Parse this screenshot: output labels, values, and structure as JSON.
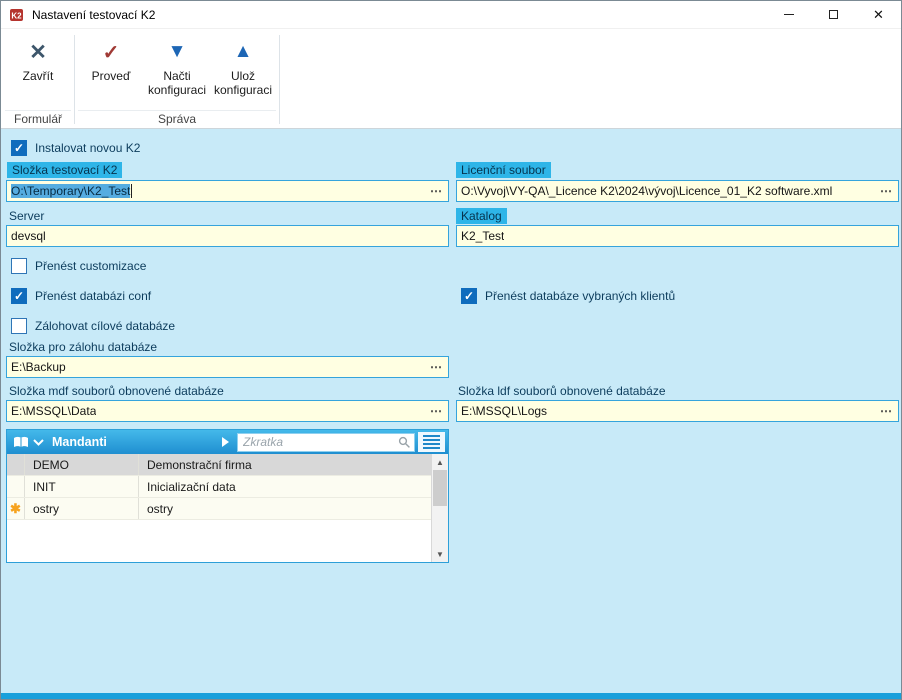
{
  "window": {
    "title": "Nastavení testovací K2"
  },
  "ribbon": {
    "groups": [
      "Formulář",
      "Správa"
    ],
    "buttons": [
      {
        "label": "Zavřít",
        "icon": "close-x-icon"
      },
      {
        "label": "Proveď",
        "icon": "execute-check-icon"
      },
      {
        "label": "Načti konfiguraci",
        "icon": "arrow-down-icon"
      },
      {
        "label": "Ulož konfiguraci",
        "icon": "arrow-up-icon"
      }
    ]
  },
  "form": {
    "install_checkbox": {
      "label": "Instalovat novou K2",
      "checked": true
    },
    "fields": {
      "test_folder": {
        "label": "Složka testovací K2",
        "value": "O:\\Temporary\\K2_Test",
        "selected": true
      },
      "license_file": {
        "label": "Licenční soubor",
        "value": "O:\\Vyvoj\\VY-QA\\_Licence K2\\2024\\vývoj\\Licence_01_K2 software.xml"
      },
      "server": {
        "label": "Server",
        "value": "devsql"
      },
      "catalog": {
        "label": "Katalog",
        "value": "K2_Test"
      },
      "backup_folder": {
        "label": "Složka pro zálohu databáze",
        "value": "E:\\Backup"
      },
      "mdf_folder": {
        "label": "Složka mdf souborů obnovené databáze",
        "value": "E:\\MSSQL\\Data"
      },
      "ldf_folder": {
        "label": "Složka ldf souborů obnovené databáze",
        "value": "E:\\MSSQL\\Logs"
      }
    },
    "checkboxes": [
      {
        "label": "Přenést customizace",
        "checked": false
      },
      {
        "label": "Přenést databázi conf",
        "checked": true
      },
      {
        "label": "Přenést databáze vybraných klientů",
        "checked": true
      },
      {
        "label": "Zálohovat cílové databáze",
        "checked": false
      }
    ]
  },
  "grid": {
    "title": "Mandanti",
    "search_placeholder": "Zkratka",
    "rows": [
      {
        "marker": "",
        "code": "DEMO",
        "name": "Demonstrační firma",
        "selected": true
      },
      {
        "marker": "",
        "code": "INIT",
        "name": "Inicializační data",
        "selected": false
      },
      {
        "marker": "✱",
        "code": "ostry",
        "name": "ostry",
        "selected": false
      }
    ]
  },
  "colors": {
    "panel_bg": "#c8eaf8",
    "label_highlight": "#2eb5e8",
    "field_bg": "#ffffe2",
    "field_border": "#35a4dc",
    "checkbox_checked": "#0f6cbd",
    "grid_header": "#1f8ed0",
    "marker_orange": "#f6a21d",
    "bottom_strip": "#19a0dc"
  }
}
